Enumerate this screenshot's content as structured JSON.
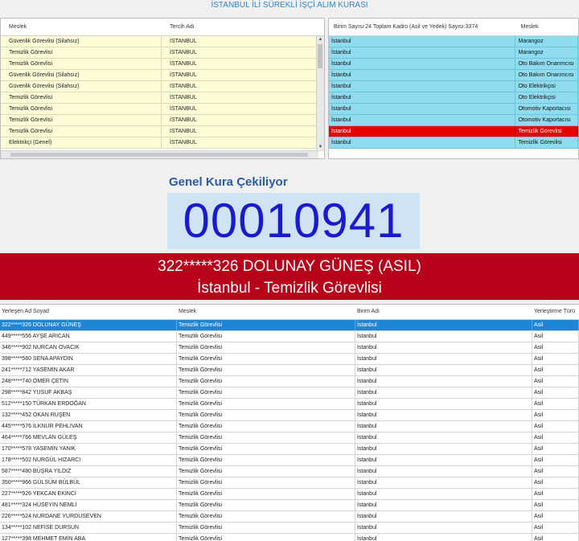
{
  "title": "İSTANBUL İLİ SÜREKLİ İŞÇİ ALIM KURASI",
  "left_grid": {
    "columns": [
      "Meslek",
      "Tercih Adı"
    ],
    "rows": [
      [
        "Güvenlik Görevlisi (Silahsız)",
        "İSTANBUL"
      ],
      [
        "Temizlik Görevlisi",
        "İSTANBUL"
      ],
      [
        "Temizlik Görevlisi",
        "İSTANBUL"
      ],
      [
        "Güvenlik Görevlisi (Silahsız)",
        "İSTANBUL"
      ],
      [
        "Güvenlik Görevlisi (Silahsız)",
        "İSTANBUL"
      ],
      [
        "Temizlik Görevlisi",
        "İSTANBUL"
      ],
      [
        "Temizlik Görevlisi",
        "İSTANBUL"
      ],
      [
        "Temizlik Görevlisi",
        "İSTANBUL"
      ],
      [
        "Temizlik Görevlisi",
        "İSTANBUL"
      ],
      [
        "Elektrikçi (Genel)",
        "İSTANBUL"
      ]
    ]
  },
  "right_grid": {
    "columns": [
      "Birim Sayısı:24 Toplam Kadro (Asil ve Yedek) Sayısı:3374",
      "Meslek"
    ],
    "selected_index": 8,
    "rows": [
      [
        "İstanbul",
        "Marangoz"
      ],
      [
        "İstanbul",
        "Marangoz"
      ],
      [
        "İstanbul",
        "Oto Bakım Onarımcısı"
      ],
      [
        "İstanbul",
        "Oto Bakım Onarımcısı"
      ],
      [
        "İstanbul",
        "Oto Elektrikçisi"
      ],
      [
        "İstanbul",
        "Oto Elektrikçisi"
      ],
      [
        "İstanbul",
        "Otomotiv Kaportacısı"
      ],
      [
        "İstanbul",
        "Otomotiv Kaportacısı"
      ],
      [
        "İstanbul",
        "Temizlik Görevlisi"
      ],
      [
        "İstanbul",
        "Temizlik Görevlisi"
      ]
    ]
  },
  "draw": {
    "label": "Genel Kura Çekiliyor",
    "number": "00010941"
  },
  "winner": {
    "line1": "322*****326 DOLUNAY GÜNEŞ (ASIL)",
    "line2": "İstanbul - Temizlik Görevlisi"
  },
  "results": {
    "columns": [
      "Yerleşen Ad Soyad",
      "Meslek",
      "Birim Adı",
      "Yerleştirme Türü"
    ],
    "selected_index": 0,
    "rows": [
      [
        "322*****326 DOLUNAY GÜNEŞ",
        "Temizlik Görevlisi",
        "İstanbul",
        "Asil"
      ],
      [
        "449*****556 AYŞE ARICAN",
        "Temizlik Görevlisi",
        "İstanbul",
        "Asil"
      ],
      [
        "346*****902 NURCAN OVACIK",
        "Temizlik Görevlisi",
        "İstanbul",
        "Asil"
      ],
      [
        "398*****560 SENA APAYDIN",
        "Temizlik Görevlisi",
        "İstanbul",
        "Asil"
      ],
      [
        "241*****712 YASEMİN AKAR",
        "Temizlik Görevlisi",
        "İstanbul",
        "Asil"
      ],
      [
        "248*****740 ÖMER ÇETİN",
        "Temizlik Görevlisi",
        "İstanbul",
        "Asil"
      ],
      [
        "298*****842 YUSUF AKBAŞ",
        "Temizlik Görevlisi",
        "İstanbul",
        "Asil"
      ],
      [
        "512*****150 TÜRKAN ERDOĞAN",
        "Temizlik Görevlisi",
        "İstanbul",
        "Asil"
      ],
      [
        "132*****452 OKAN RUŞEN",
        "Temizlik Görevlisi",
        "İstanbul",
        "Asil"
      ],
      [
        "445*****576 İLKNUR PEHLİVAN",
        "Temizlik Görevlisi",
        "İstanbul",
        "Asil"
      ],
      [
        "464*****766 MEVLAN GÜLEŞ",
        "Temizlik Görevlisi",
        "İstanbul",
        "Asil"
      ],
      [
        "170*****578 YASEMİN YANIK",
        "Temizlik Görevlisi",
        "İstanbul",
        "Asil"
      ],
      [
        "178*****502 NURGÜL HIZARCI",
        "Temizlik Görevlisi",
        "İstanbul",
        "Asil"
      ],
      [
        "587*****480 BÜŞRA YILDIZ",
        "Temizlik Görevlisi",
        "İstanbul",
        "Asil"
      ],
      [
        "350*****966 GÜLSÜM BÜLBÜL",
        "Temizlik Görevlisi",
        "İstanbul",
        "Asil"
      ],
      [
        "227*****926 YEKCAN EKİNCİ",
        "Temizlik Görevlisi",
        "İstanbul",
        "Asil"
      ],
      [
        "481*****324 HÜSEYİN NEMLİ",
        "Temizlik Görevlisi",
        "İstanbul",
        "Asil"
      ],
      [
        "226*****524 NURDANE YURDUSEVEN",
        "Temizlik Görevlisi",
        "İstanbul",
        "Asil"
      ],
      [
        "134*****102 NEFİSE DURSUN",
        "Temizlik Görevlisi",
        "İstanbul",
        "Asil"
      ],
      [
        "127*****398 MEHMET EMİN ABA",
        "Temizlik Görevlisi",
        "İstanbul",
        "Asil"
      ]
    ]
  }
}
